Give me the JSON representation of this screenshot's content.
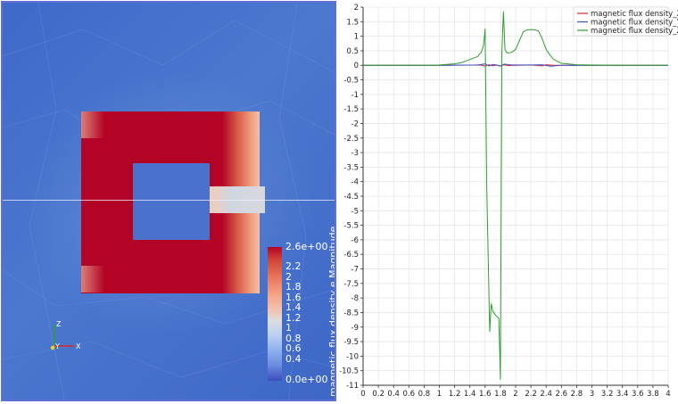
{
  "render_view": {
    "scalar_bar": {
      "title": "magnetic flux density e Magnitude",
      "max_label": "2.6e+00",
      "min_label": "0.0e+00",
      "labels": [
        "2.2",
        "2",
        "1.8",
        "1.6",
        "1.4",
        "1.2",
        "1",
        "0.8",
        "0.6",
        "0.4"
      ],
      "label_values": [
        2.2,
        2.0,
        1.8,
        1.6,
        1.4,
        1.2,
        1.0,
        0.8,
        0.6,
        0.4
      ],
      "range": [
        0,
        2.6
      ]
    },
    "axes": {
      "x": "X",
      "y": "Y",
      "z": "Z"
    },
    "colors": {
      "core": "#b40426",
      "background": "#4570cb",
      "frame_border": "#5f6fd6"
    }
  },
  "chart_data": {
    "type": "line",
    "title": "",
    "xlabel": "",
    "ylabel": "",
    "xlim": [
      0,
      4
    ],
    "ylim": [
      -11,
      2
    ],
    "grid": true,
    "legend_placement": "top-right",
    "x_tick_labels": [
      "0",
      "0.2",
      "0.4",
      "0.6",
      "0.8",
      "1",
      "1.2",
      "1.4",
      "1.6",
      "1.8",
      "2",
      "2.2",
      "2.4",
      "2.6",
      "2.8",
      "3",
      "3.2",
      "3.4",
      "3.6",
      "3.8",
      "4"
    ],
    "x_tick_values": [
      0,
      0.2,
      0.4,
      0.6,
      0.8,
      1,
      1.2,
      1.4,
      1.6,
      1.8,
      2,
      2.2,
      2.4,
      2.6,
      2.8,
      3,
      3.2,
      3.4,
      3.6,
      3.8,
      4
    ],
    "y_tick_labels": [
      "2",
      "1.5",
      "1",
      "0.5",
      "0",
      "-0.5",
      "-1",
      "-1.5",
      "-2",
      "-2.5",
      "-3",
      "-3.5",
      "-4",
      "-4.5",
      "-5",
      "-5.5",
      "-6",
      "-6.5",
      "-7",
      "-7.5",
      "-8",
      "-8.5",
      "-9",
      "-9.5",
      "-10",
      "-10.5",
      "-11"
    ],
    "y_tick_values": [
      2,
      1.5,
      1,
      0.5,
      0,
      -0.5,
      -1,
      -1.5,
      -2,
      -2.5,
      -3,
      -3.5,
      -4,
      -4.5,
      -5,
      -5.5,
      -6,
      -6.5,
      -7,
      -7.5,
      -8,
      -8.5,
      -9,
      -9.5,
      -10,
      -10.5,
      -11
    ],
    "series": [
      {
        "name": "magnetic flux density_X",
        "color": "#d62728",
        "x": [
          0,
          1.0,
          1.55,
          1.6,
          1.65,
          1.7,
          1.75,
          1.8,
          1.85,
          1.9,
          2.0,
          2.2,
          2.35,
          2.4,
          2.5,
          3.0,
          4.0
        ],
        "y": [
          0,
          0,
          0.01,
          -0.03,
          0.02,
          -0.02,
          0.01,
          -0.02,
          0.02,
          -0.01,
          0,
          0.01,
          -0.02,
          0.02,
          0,
          0,
          0
        ]
      },
      {
        "name": "magnetic flux density_Y",
        "color": "#3a55c8",
        "x": [
          0,
          1.0,
          1.5,
          1.6,
          1.65,
          1.7,
          1.75,
          1.8,
          1.85,
          1.95,
          2.2,
          2.35,
          2.45,
          2.6,
          3.0,
          4.0
        ],
        "y": [
          0,
          0,
          0.01,
          0.05,
          -0.02,
          0.03,
          0.01,
          -0.03,
          0.04,
          0.01,
          0.01,
          0.02,
          -0.03,
          0,
          0,
          0
        ]
      },
      {
        "name": "magnetic flux density_Z",
        "color": "#2ca02c",
        "x": [
          0,
          0.8,
          1.0,
          1.2,
          1.3,
          1.4,
          1.45,
          1.5,
          1.55,
          1.58,
          1.6,
          1.62,
          1.66,
          1.68,
          1.7,
          1.74,
          1.78,
          1.8,
          1.82,
          1.84,
          1.86,
          1.88,
          1.9,
          1.95,
          2.0,
          2.05,
          2.1,
          2.15,
          2.2,
          2.25,
          2.3,
          2.35,
          2.4,
          2.45,
          2.5,
          2.6,
          2.8,
          3.0,
          3.5,
          4.0
        ],
        "y": [
          0,
          0,
          0.01,
          0.05,
          0.1,
          0.2,
          0.25,
          0.3,
          0.45,
          0.7,
          1.25,
          -4.0,
          -9.15,
          -8.2,
          -8.45,
          -8.6,
          -8.7,
          -10.8,
          0.5,
          1.85,
          0.55,
          0.45,
          0.42,
          0.45,
          0.55,
          0.85,
          1.15,
          1.22,
          1.23,
          1.22,
          1.18,
          0.9,
          0.55,
          0.35,
          0.2,
          0.07,
          0.02,
          0.01,
          0,
          0
        ]
      }
    ]
  }
}
